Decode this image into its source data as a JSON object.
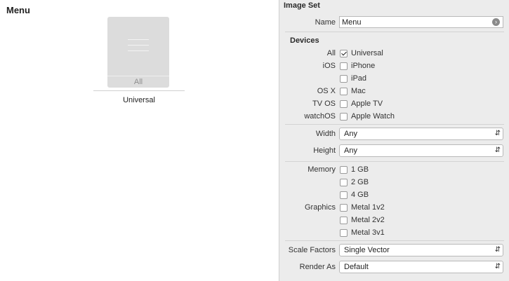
{
  "canvas": {
    "title": "Menu",
    "slot_label": "All",
    "group_label": "Universal"
  },
  "inspector": {
    "header": "Image Set",
    "name_label": "Name",
    "name_value": "Menu",
    "devices_header": "Devices",
    "devices": [
      {
        "group": "All",
        "label": "Universal",
        "checked": true
      },
      {
        "group": "iOS",
        "label": "iPhone",
        "checked": false
      },
      {
        "group": "",
        "label": "iPad",
        "checked": false
      },
      {
        "group": "OS X",
        "label": "Mac",
        "checked": false
      },
      {
        "group": "TV OS",
        "label": "Apple TV",
        "checked": false
      },
      {
        "group": "watchOS",
        "label": "Apple Watch",
        "checked": false
      }
    ],
    "width_label": "Width",
    "width_value": "Any",
    "height_label": "Height",
    "height_value": "Any",
    "memory_label": "Memory",
    "memory": [
      {
        "label": "1 GB",
        "checked": false
      },
      {
        "label": "2 GB",
        "checked": false
      },
      {
        "label": "4 GB",
        "checked": false
      }
    ],
    "graphics_label": "Graphics",
    "graphics": [
      {
        "label": "Metal 1v2",
        "checked": false
      },
      {
        "label": "Metal 2v2",
        "checked": false
      },
      {
        "label": "Metal 3v1",
        "checked": false
      }
    ],
    "scale_label": "Scale Factors",
    "scale_value": "Single Vector",
    "render_label": "Render As",
    "render_value": "Default"
  }
}
